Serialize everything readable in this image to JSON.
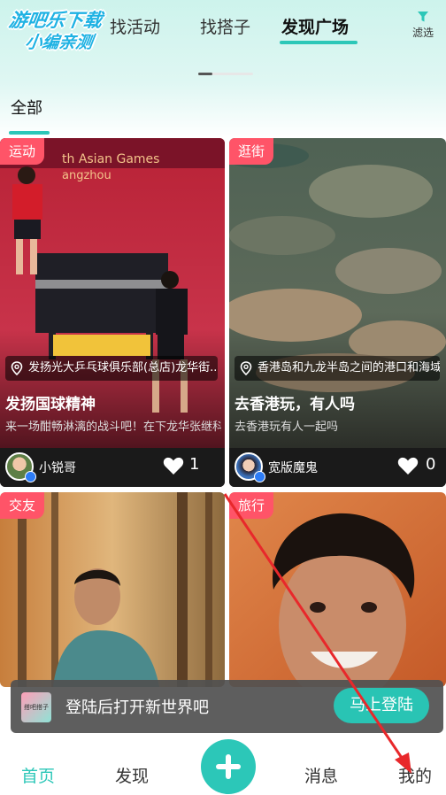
{
  "watermark": {
    "line1": "游吧乐下载",
    "line2": "小编亲测"
  },
  "top_tabs": [
    "找活动",
    "找搭子",
    "发现广场"
  ],
  "filter": {
    "label": "滤选",
    "icon": "filter-icon"
  },
  "category": {
    "label": "全部"
  },
  "cards": [
    {
      "tag": "运动",
      "location": "发扬光大乒乓球俱乐部(总店)龙华街...",
      "title": "发扬国球精神",
      "desc": "来一场酣畅淋漓的战斗吧！在下龙华张继科...",
      "user": "小锐哥",
      "likes": "1"
    },
    {
      "tag": "逛街",
      "location": "香港岛和九龙半岛之间的港口和海域...",
      "title": "去香港玩，有人吗",
      "desc": "去香港玩有人一起吗",
      "user": "宽版魔鬼",
      "likes": "0"
    },
    {
      "tag": "交友"
    },
    {
      "tag": "旅行"
    }
  ],
  "banner": {
    "logo_text": "搭吧搭子",
    "text": "登陆后打开新世界吧",
    "button": "马上登陆"
  },
  "nav": {
    "home": "首页",
    "discover": "发现",
    "messages": "消息",
    "me": "我的"
  },
  "colors": {
    "accent": "#2cc7b8",
    "tag": "#ff5468",
    "annotation": "#e8282b"
  }
}
